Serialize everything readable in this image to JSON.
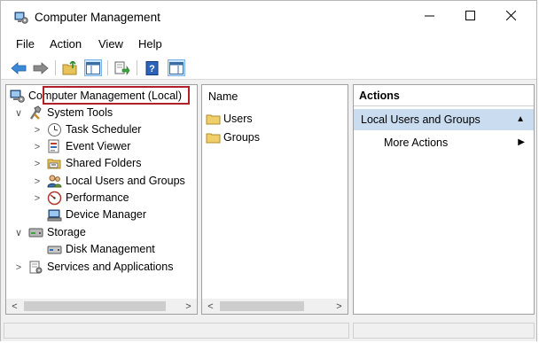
{
  "window": {
    "title": "Computer Management",
    "min_glyph": "—",
    "max_glyph": "☐",
    "close_glyph": "✕"
  },
  "menu": {
    "items": [
      "File",
      "Action",
      "View",
      "Help"
    ]
  },
  "tree": {
    "root": "Computer Management (Local)",
    "system_tools": "System Tools",
    "task_scheduler": "Task Scheduler",
    "event_viewer": "Event Viewer",
    "shared_folders": "Shared Folders",
    "local_users": "Local Users and Groups",
    "performance": "Performance",
    "device_manager": "Device Manager",
    "storage": "Storage",
    "disk_management": "Disk Management",
    "services": "Services and Applications",
    "expanded": "∨",
    "collapsed": ">"
  },
  "list": {
    "column": "Name",
    "items": [
      "Users",
      "Groups"
    ]
  },
  "actions": {
    "header": "Actions",
    "section": "Local Users and Groups",
    "section_glyph": "▲",
    "more": "More Actions",
    "more_glyph": "▶"
  },
  "scrollbars": {
    "left": "<",
    "right": ">"
  },
  "colors": {
    "selection_border": "#b0202a",
    "actions_section_bg": "#c9dcf0"
  },
  "icons": [
    "back-icon",
    "forward-icon",
    "up-folder-icon",
    "show-hide-tree-icon",
    "export-list-icon",
    "help-icon",
    "properties-icon"
  ]
}
